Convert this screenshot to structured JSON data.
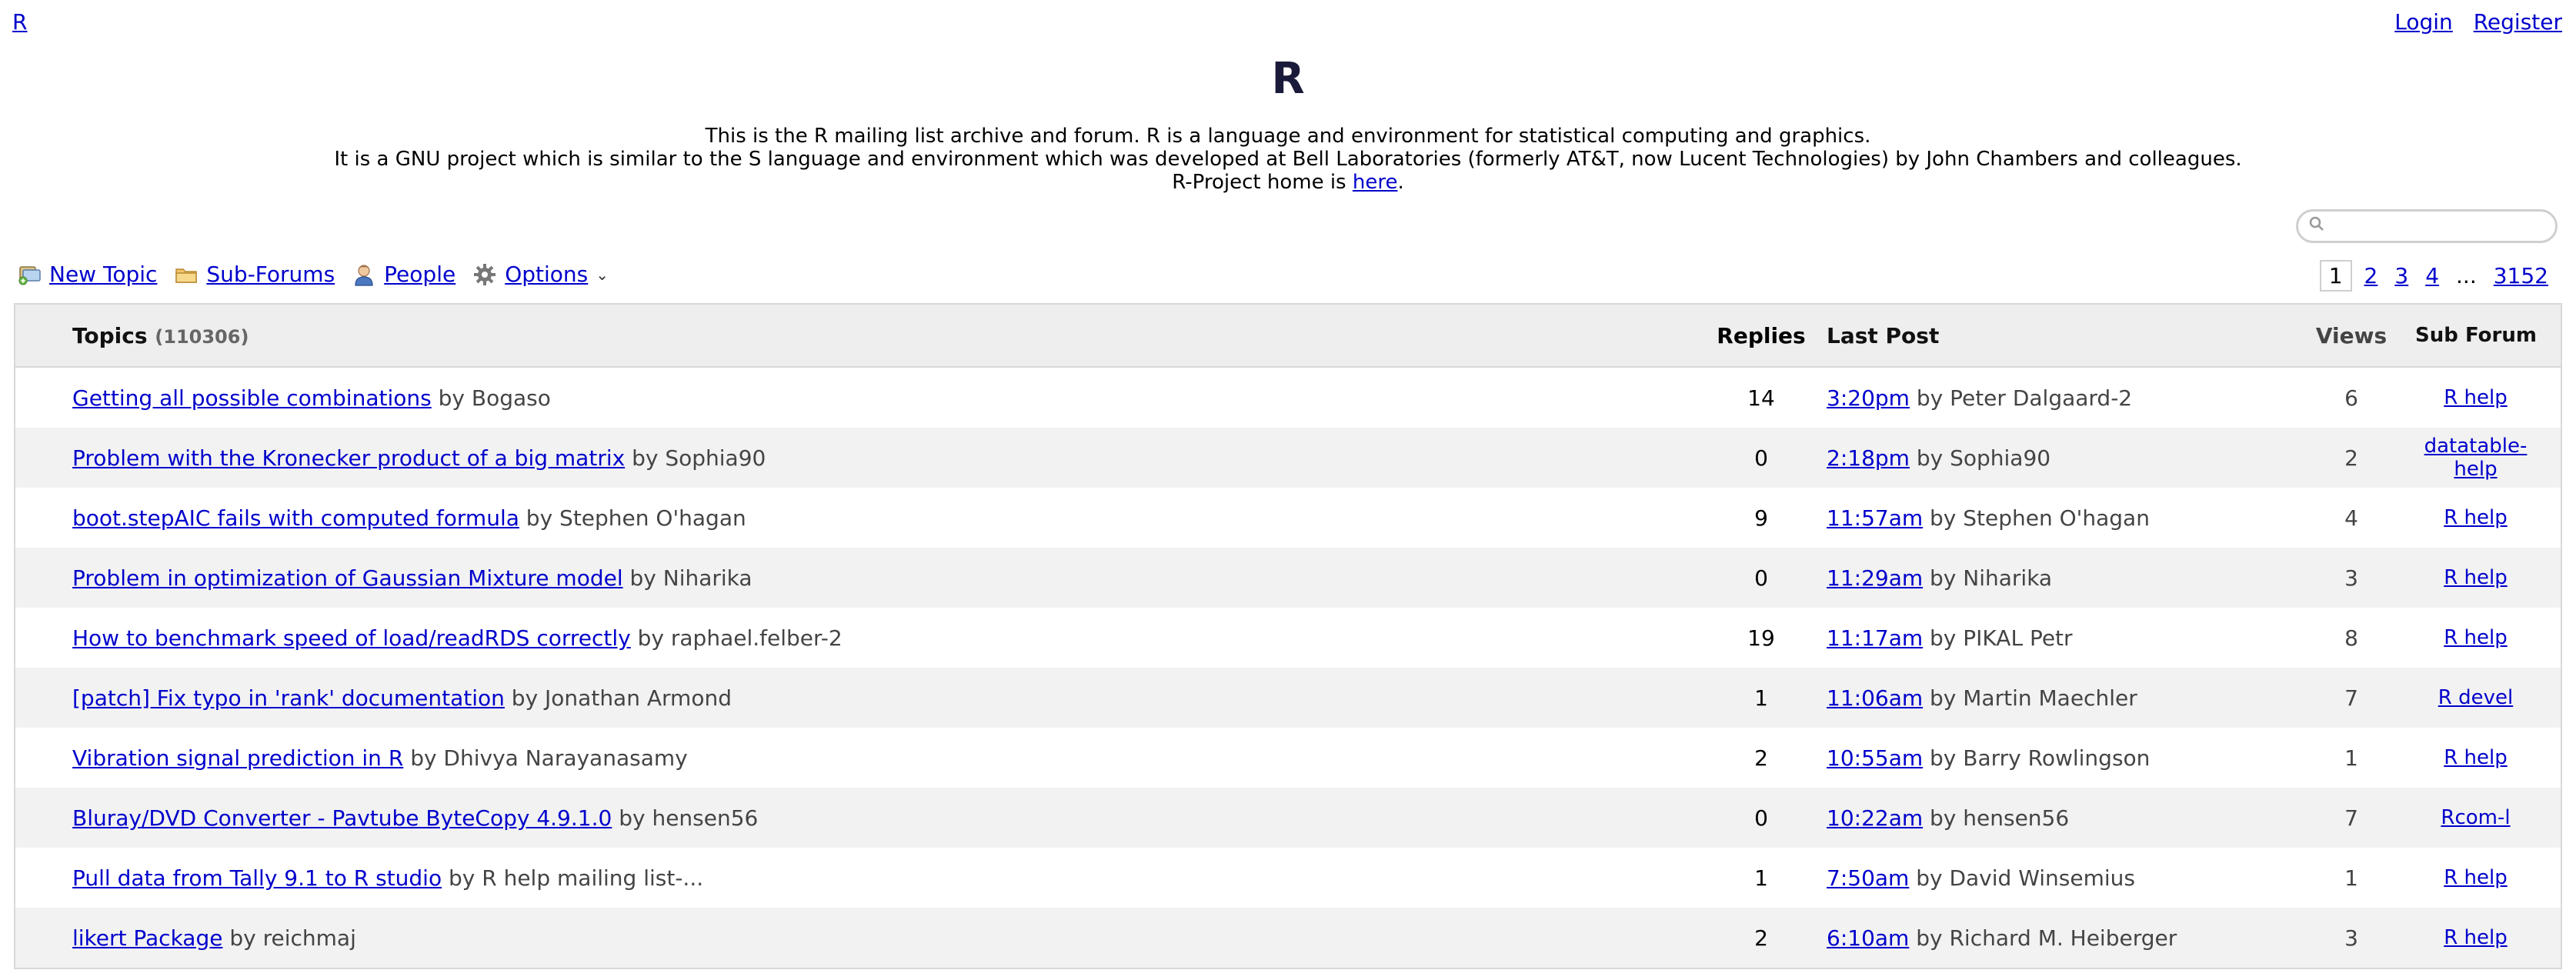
{
  "header": {
    "home_link": "R",
    "login": "Login",
    "register": "Register",
    "title": "R",
    "description_line1": "This is the R mailing list archive and forum. R is a language and environment for statistical computing and graphics.",
    "description_line2": "It is a GNU project which is similar to the S language and environment which was developed at Bell Laboratories (formerly AT&T, now Lucent Technologies) by John Chambers and colleagues.",
    "description_line3_prefix": "R-Project home is ",
    "description_line3_link": "here",
    "description_line3_suffix": "."
  },
  "search": {
    "placeholder": "",
    "icon": "search-icon"
  },
  "toolbar": {
    "new_topic": "New Topic",
    "sub_forums": "Sub-Forums",
    "people": "People",
    "options": "Options"
  },
  "pager": {
    "current": "1",
    "p2": "2",
    "p3": "3",
    "p4": "4",
    "ellipsis": "...",
    "last": "3152"
  },
  "table": {
    "col_topics": "Topics",
    "topics_count": "(110306)",
    "col_replies": "Replies",
    "col_last_post": "Last Post",
    "col_views": "Views",
    "col_sub_forum": "Sub Forum",
    "rows": [
      {
        "title": "Getting all possible combinations",
        "author": "by Bogaso",
        "replies": "14",
        "time": "3:20pm",
        "last_by": "by Peter Dalgaard-2",
        "views": "6",
        "forum": "R help"
      },
      {
        "title": "Problem with the Kronecker product of a big matrix",
        "author": "by Sophia90",
        "replies": "0",
        "time": "2:18pm",
        "last_by": "by Sophia90",
        "views": "2",
        "forum": "datatable-help"
      },
      {
        "title": "boot.stepAIC fails with computed formula",
        "author": "by Stephen O'hagan",
        "replies": "9",
        "time": "11:57am",
        "last_by": "by Stephen O'hagan",
        "views": "4",
        "forum": "R help"
      },
      {
        "title": "Problem in optimization of Gaussian Mixture model",
        "author": "by Niharika",
        "replies": "0",
        "time": "11:29am",
        "last_by": "by Niharika",
        "views": "3",
        "forum": "R help"
      },
      {
        "title": "How to benchmark speed of load/readRDS correctly",
        "author": "by raphael.felber-2",
        "replies": "19",
        "time": "11:17am",
        "last_by": "by PIKAL Petr",
        "views": "8",
        "forum": "R help"
      },
      {
        "title": "[patch] Fix typo in 'rank' documentation",
        "author": "by Jonathan Armond",
        "replies": "1",
        "time": "11:06am",
        "last_by": "by Martin Maechler",
        "views": "7",
        "forum": "R devel"
      },
      {
        "title": "Vibration signal prediction in R",
        "author": "by Dhivya Narayanasamy",
        "replies": "2",
        "time": "10:55am",
        "last_by": "by Barry Rowlingson",
        "views": "1",
        "forum": "R help"
      },
      {
        "title": "Bluray/DVD Converter - Pavtube ByteCopy 4.9.1.0",
        "author": "by hensen56",
        "replies": "0",
        "time": "10:22am",
        "last_by": "by hensen56",
        "views": "7",
        "forum": "Rcom-l"
      },
      {
        "title": "Pull data from Tally 9.1 to R studio",
        "author": "by R help mailing list-...",
        "replies": "1",
        "time": "7:50am",
        "last_by": "by David Winsemius",
        "views": "1",
        "forum": "R help"
      },
      {
        "title": "likert Package",
        "author": "by reichmaj",
        "replies": "2",
        "time": "6:10am",
        "last_by": "by Richard M. Heiberger",
        "views": "3",
        "forum": "R help"
      }
    ]
  }
}
